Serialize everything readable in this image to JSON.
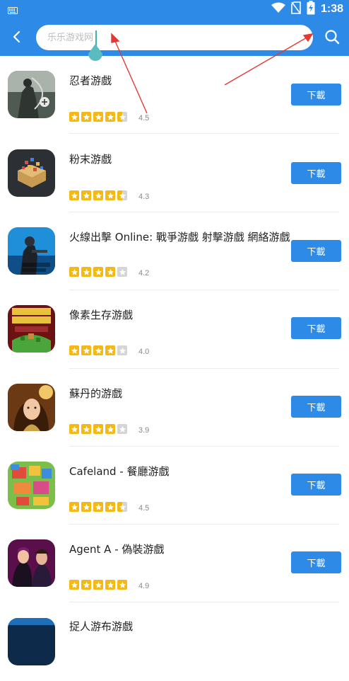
{
  "status_bar": {
    "time": "1:38",
    "icons": [
      "keyboard-icon",
      "wifi-icon",
      "no-sim-icon",
      "battery-charging-icon"
    ]
  },
  "header": {
    "back_icon": "chevron-left-icon",
    "search": {
      "placeholder": "乐乐游戏网",
      "value": ""
    },
    "search_icon": "search-icon",
    "background": "#2d8ae7"
  },
  "apps": [
    {
      "name": "忍者游戲",
      "rating": "4.5",
      "stars": [
        1,
        1,
        1,
        1,
        0.5
      ],
      "button": "下載",
      "icon": "ninja-game-icon"
    },
    {
      "name": "粉末游戲",
      "rating": "4.3",
      "stars": [
        1,
        1,
        1,
        1,
        0.5
      ],
      "button": "下載",
      "icon": "powder-game-icon"
    },
    {
      "name": "火線出擊 Online: 戰爭游戲 射擊游戲 網絡游戲",
      "rating": "4.2",
      "stars": [
        1,
        1,
        1,
        1,
        0
      ],
      "button": "下載",
      "icon": "modern-strike-icon"
    },
    {
      "name": "像素生存游戲",
      "rating": "4.0",
      "stars": [
        1,
        1,
        1,
        1,
        0
      ],
      "button": "下載",
      "icon": "pixel-survival-icon"
    },
    {
      "name": "蘇丹的游戲",
      "rating": "3.9",
      "stars": [
        1,
        1,
        1,
        1,
        0
      ],
      "button": "下載",
      "icon": "sultan-game-icon"
    },
    {
      "name": "Cafeland - 餐廳游戲",
      "rating": "4.5",
      "stars": [
        1,
        1,
        1,
        1,
        0.5
      ],
      "button": "下載",
      "icon": "cafeland-icon"
    },
    {
      "name": "Agent A - 偽裝游戲",
      "rating": "4.9",
      "stars": [
        1,
        1,
        1,
        1,
        1
      ],
      "button": "下載",
      "icon": "agent-a-icon"
    },
    {
      "name": "捉人游布游戲",
      "rating": "",
      "stars": [],
      "button": "",
      "icon": "partial-app-icon"
    }
  ],
  "accent_color": "#2d8ae7",
  "star_color": "#f4b914",
  "annotation_color": "#e53935"
}
